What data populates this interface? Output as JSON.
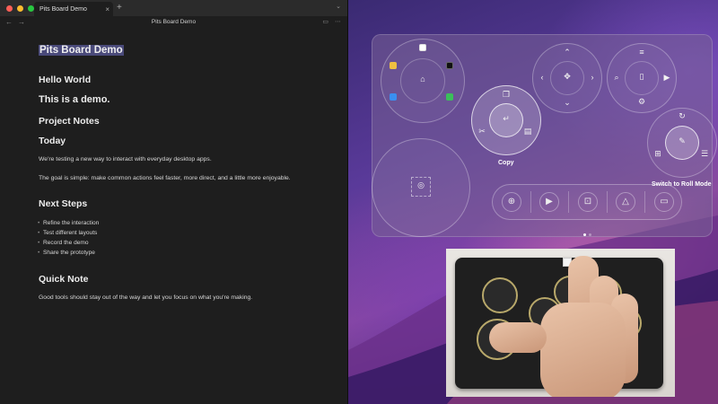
{
  "editor": {
    "tab_title": "Pits Board Demo",
    "doc_title": "Pits Board Demo",
    "heading": "Pits Board Demo",
    "sections": {
      "hello": "Hello World",
      "demo": "This is a demo.",
      "project": "Project Notes",
      "today": "Today",
      "p1": "We're testing a new way to interact with everyday desktop apps.",
      "p2": "The goal is simple: make common actions feel faster, more direct, and a little more enjoyable.",
      "next": "Next Steps",
      "steps": [
        "Refine the interaction",
        "Test different layouts",
        "Record the demo",
        "Share the prototype"
      ],
      "quick": "Quick Note",
      "p3": "Good tools should stay out of the way and let you focus on what you're making."
    }
  },
  "panel": {
    "copy_label": "Copy",
    "roll_label": "Switch to Roll Mode"
  },
  "colors": {
    "accent_highlight": "#4a4a7a",
    "editor_bg": "#1e1e1e"
  }
}
